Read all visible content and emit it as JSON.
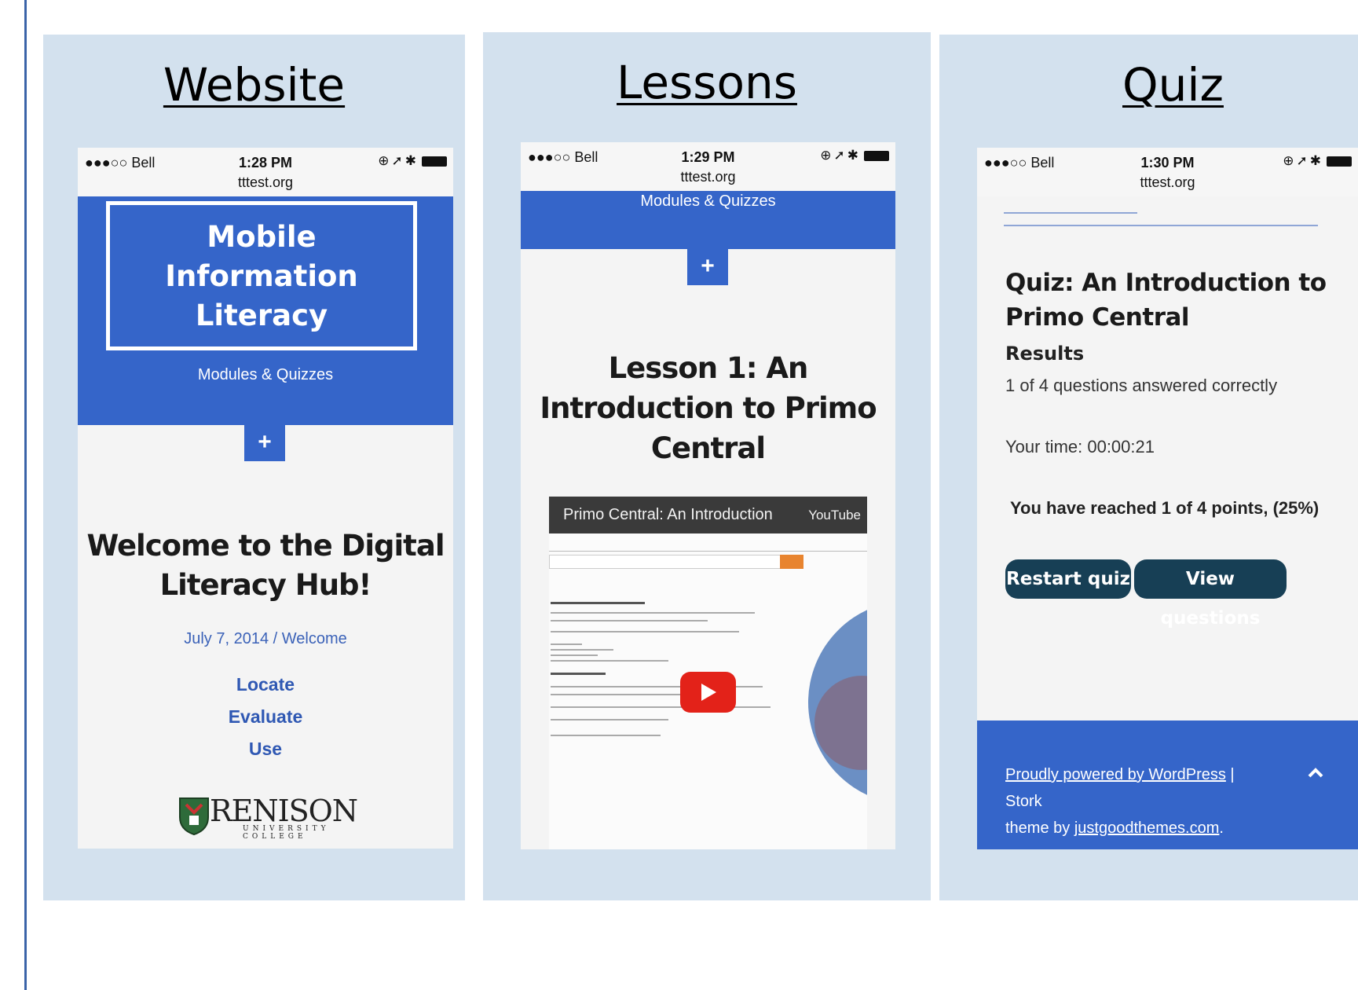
{
  "panels": [
    {
      "title": "Website"
    },
    {
      "title": "Lessons"
    },
    {
      "title": "Quiz"
    }
  ],
  "website": {
    "carrier": "●●●○○ Bell",
    "time": "1:28 PM",
    "url": "tttest.org",
    "logo_line1": "Mobile",
    "logo_line2": "Information",
    "logo_line3": "Literacy",
    "subtitle": "Modules & Quizzes",
    "plus": "+",
    "heading_line1": "Welcome to the Digital",
    "heading_line2": "Literacy Hub!",
    "meta": "July 7, 2014 / Welcome",
    "links": [
      "Locate",
      "Evaluate",
      "Use"
    ],
    "college_name": "RENISON",
    "college_sub": "UNIVERSITY COLLEGE"
  },
  "lessons": {
    "carrier": "●●●○○ Bell",
    "time": "1:29 PM",
    "url": "tttest.org",
    "subtitle": "Modules & Quizzes",
    "plus": "+",
    "heading_line1": "Lesson 1: An",
    "heading_line2": "Introduction to Primo",
    "heading_line3": "Central",
    "video_title": "Primo Central: An Introduction",
    "video_source": "YouTube"
  },
  "quiz": {
    "carrier": "●●●○○ Bell",
    "time": "1:30 PM",
    "url": "tttest.org",
    "heading_line1": "Quiz: An Introduction to",
    "heading_line2": "Primo Central",
    "results_label": "Results",
    "answered": "1 of 4 questions answered correctly",
    "time_text": "Your time: 00:00:21",
    "points": "You have reached 1 of 4 points, (25%)",
    "restart_label": "Restart quiz",
    "view_label": "View questions",
    "footer_link1": "Proudly powered by WordPress",
    "footer_sep": " | Stork",
    "footer_line2_prefix": "theme by ",
    "footer_link2": "justgoodthemes.com",
    "footer_period": "."
  }
}
